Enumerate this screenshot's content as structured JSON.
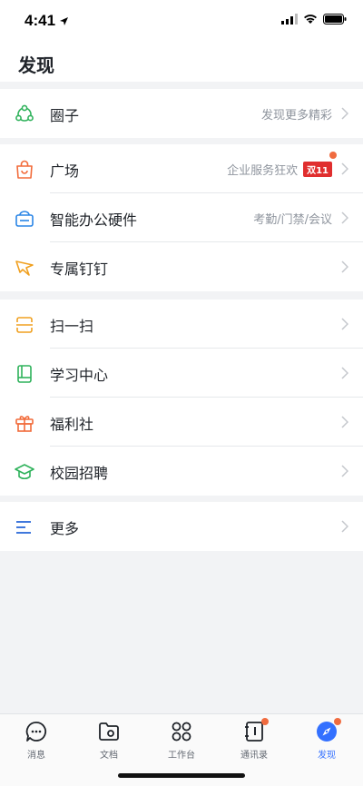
{
  "status": {
    "time": "4:41"
  },
  "header": {
    "title": "发现"
  },
  "groups": [
    {
      "items": [
        {
          "label": "圈子",
          "sub": "发现更多精彩",
          "icon": "circle-network-icon",
          "color": "#2fb25b"
        }
      ]
    },
    {
      "items": [
        {
          "label": "广场",
          "sub": "企业服务狂欢",
          "badge": "双11",
          "icon": "shopping-bag-icon",
          "color": "#f26b3a"
        },
        {
          "label": "智能办公硬件",
          "sub": "考勤/门禁/会议",
          "icon": "device-icon",
          "color": "#2a85e6"
        },
        {
          "label": "专属钉钉",
          "icon": "ding-icon",
          "color": "#f0a020"
        }
      ]
    },
    {
      "items": [
        {
          "label": "扫一扫",
          "icon": "scan-icon",
          "color": "#f0a020"
        },
        {
          "label": "学习中心",
          "icon": "book-icon",
          "color": "#2fb25b"
        },
        {
          "label": "福利社",
          "icon": "gift-icon",
          "color": "#f26b3a"
        },
        {
          "label": "校园招聘",
          "icon": "graduation-cap-icon",
          "color": "#2fb25b"
        }
      ]
    },
    {
      "items": [
        {
          "label": "更多",
          "icon": "more-lines-icon",
          "color": "#2b6ad8"
        }
      ]
    }
  ],
  "tabs": [
    {
      "label": "消息",
      "icon": "message-icon"
    },
    {
      "label": "文档",
      "icon": "document-icon"
    },
    {
      "label": "工作台",
      "icon": "workbench-icon"
    },
    {
      "label": "通讯录",
      "icon": "contacts-icon"
    },
    {
      "label": "发现",
      "icon": "discover-icon",
      "active": true
    }
  ],
  "colors": {
    "accent": "#3370ff",
    "badge": "#e02e2e",
    "dot": "#f06b3f"
  }
}
